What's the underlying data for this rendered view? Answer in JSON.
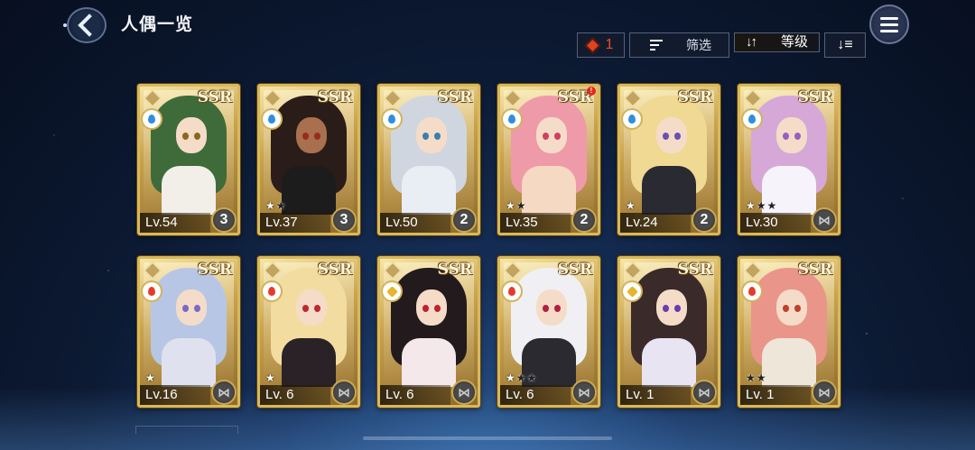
{
  "header": {
    "title": "人偶一览"
  },
  "toolbar": {
    "count": "1",
    "filter_label": "筛选",
    "level_label": "等级"
  },
  "colors": {
    "card_gold": "#d9b85a",
    "water": "#2f8ee0",
    "fire": "#e63b2a",
    "light": "#e6b52a"
  },
  "cards": [
    {
      "rarity": "SSR",
      "element": "water",
      "level": "Lv.54",
      "badge": "3",
      "stars_shown": 0,
      "stars_max": 0,
      "alert": false
    },
    {
      "rarity": "SSR",
      "element": "water",
      "level": "Lv.37",
      "badge": "3",
      "stars_shown": 1,
      "stars_max": 2,
      "alert": false
    },
    {
      "rarity": "SSR",
      "element": "water",
      "level": "Lv.50",
      "badge": "2",
      "stars_shown": 0,
      "stars_max": 0,
      "alert": false
    },
    {
      "rarity": "SSR",
      "element": "water",
      "level": "Lv.35",
      "badge": "2",
      "stars_shown": 1,
      "stars_max": 2,
      "alert": true,
      "alert_text": "!"
    },
    {
      "rarity": "SSR",
      "element": "water",
      "level": "Lv.24",
      "badge": "2",
      "stars_shown": 1,
      "stars_max": 1,
      "alert": false
    },
    {
      "rarity": "SSR",
      "element": "water",
      "level": "Lv.30",
      "badge": "",
      "stars_shown": 1,
      "stars_max": 3,
      "alert": false
    },
    {
      "rarity": "SSR",
      "element": "fire",
      "level": "Lv.16",
      "badge": "",
      "stars_shown": 1,
      "stars_max": 1,
      "alert": false
    },
    {
      "rarity": "SSR",
      "element": "fire",
      "level": "Lv. 6",
      "badge": "",
      "stars_shown": 1,
      "stars_max": 1,
      "alert": false
    },
    {
      "rarity": "SSR",
      "element": "light",
      "level": "Lv. 6",
      "badge": "",
      "stars_shown": 0,
      "stars_max": 0,
      "alert": false
    },
    {
      "rarity": "SSR",
      "element": "fire",
      "level": "Lv. 6",
      "badge": "",
      "stars_shown": 1,
      "stars_max": 3,
      "alert": false
    },
    {
      "rarity": "SSR",
      "element": "light",
      "level": "Lv. 1",
      "badge": "",
      "stars_shown": 0,
      "stars_max": 0,
      "alert": false
    },
    {
      "rarity": "SSR",
      "element": "fire",
      "level": "Lv. 1",
      "badge": "",
      "stars_shown": 0,
      "stars_max": 2,
      "alert": false
    }
  ]
}
